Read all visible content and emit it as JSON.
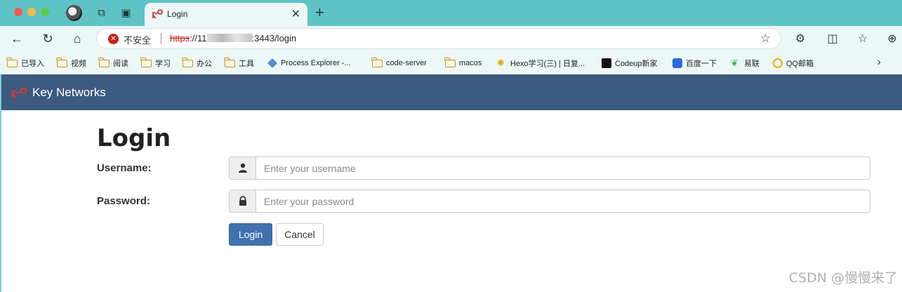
{
  "browser": {
    "tab": {
      "title": "Login",
      "close": "✕"
    },
    "new_tab": "+",
    "security_label": "不安全",
    "url": {
      "scheme": "https",
      "prefix": "://11",
      "suffix": ":3443/login"
    },
    "bookmarks": [
      "已导入",
      "视频",
      "阅读",
      "学习",
      "办公",
      "工具",
      "Process Explorer -...",
      "code-server",
      "macos",
      "Hexo学习(三) | 日复...",
      "Codeup新家",
      "百度一下",
      "易联",
      "QQ邮箱"
    ],
    "bookmarks_more": "›"
  },
  "app": {
    "brand": "Key Networks",
    "colors": {
      "navbar": "#3d5a80",
      "primary": "#3f72af"
    }
  },
  "login": {
    "title": "Login",
    "username_label": "Username:",
    "username_placeholder": "Enter your username",
    "password_label": "Password:",
    "password_placeholder": "Enter your password",
    "submit_label": "Login",
    "cancel_label": "Cancel"
  },
  "watermark": "CSDN @慢慢来了"
}
